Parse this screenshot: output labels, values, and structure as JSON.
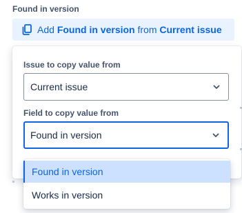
{
  "field": {
    "heading": "Found in version"
  },
  "add_button": {
    "prefix": "Add",
    "field_name": "Found in version",
    "middle": "from",
    "source": "Current issue",
    "icon": "copy-icon",
    "color": "#0c66e4",
    "background": "#e9f2ff"
  },
  "popup": {
    "source_label": "Issue to copy value from",
    "source_value": "Current issue",
    "field_label": "Field to copy value from",
    "field_value": "Found in version"
  },
  "dropdown": {
    "options": [
      {
        "label": "Found in version",
        "selected": true
      },
      {
        "label": "Works in version",
        "selected": false
      }
    ],
    "selected_background": "#cce0ff"
  }
}
